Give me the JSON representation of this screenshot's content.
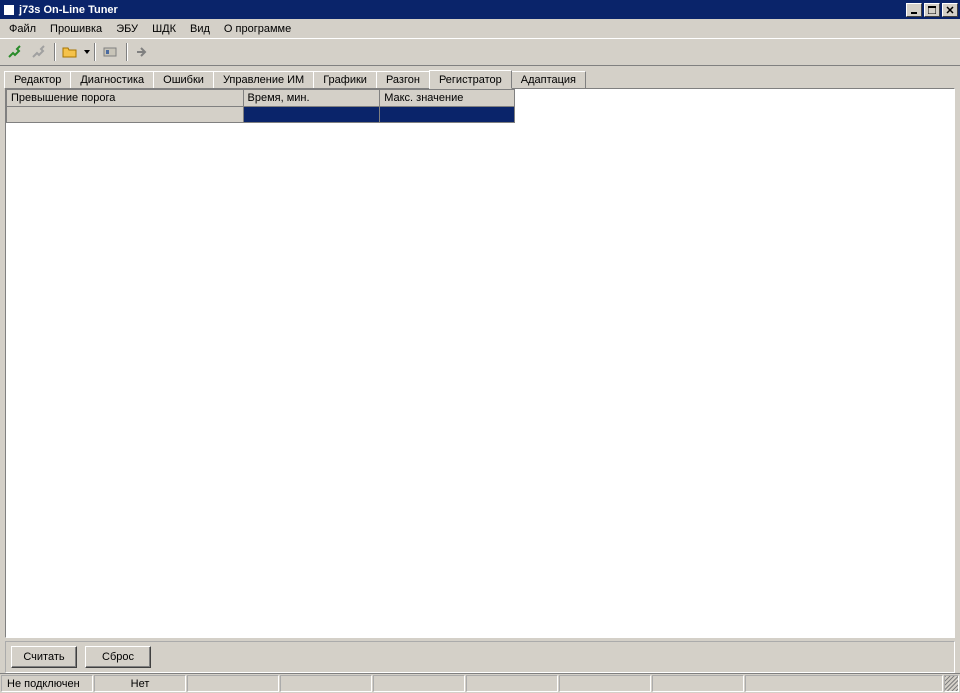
{
  "window": {
    "title": "j73s On-Line Tuner"
  },
  "menu": {
    "items": [
      "Файл",
      "Прошивка",
      "ЭБУ",
      "ШДК",
      "Вид",
      "О программе"
    ]
  },
  "toolbar": {
    "icons": [
      "connect-icon",
      "disconnect-icon",
      "open-icon",
      "snapshot-icon",
      "arrow-right-icon"
    ]
  },
  "tabs": {
    "items": [
      "Редактор",
      "Диагностика",
      "Ошибки",
      "Управление ИМ",
      "Графики",
      "Разгон",
      "Регистратор",
      "Адаптация"
    ],
    "active_index": 6
  },
  "grid": {
    "headers": [
      "Превышение порога",
      "Время, мин.",
      "Макс. значение"
    ],
    "row": [
      "",
      "",
      ""
    ]
  },
  "buttons": {
    "read": "Считать",
    "reset": "Сброс"
  },
  "status": {
    "connection": "Не подключен",
    "second": "Нет"
  }
}
